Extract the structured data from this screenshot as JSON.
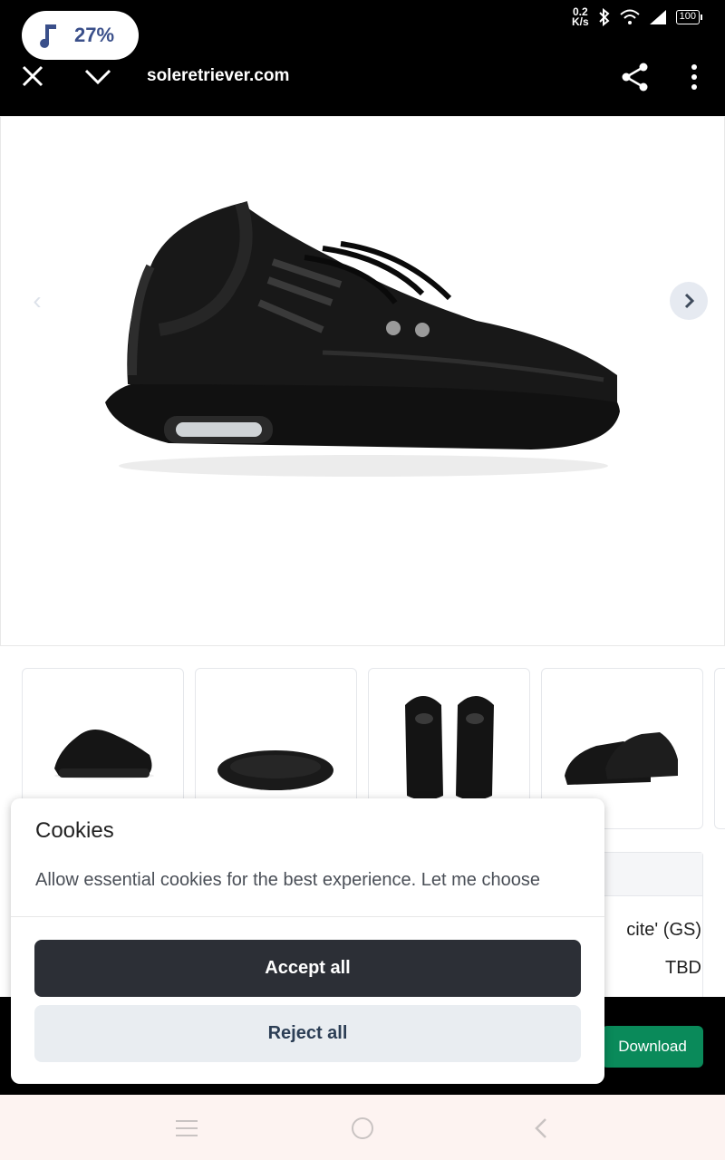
{
  "status_bar": {
    "music_percent": "27%",
    "net_speed_value": "0.2",
    "net_speed_unit": "K/s",
    "battery": "100"
  },
  "browser": {
    "url": "soleretriever.com"
  },
  "cookie_banner": {
    "title": "Cookies",
    "message": "Allow essential cookies for the best experience. Let me choose",
    "accept_label": "Accept all",
    "reject_label": "Reject all"
  },
  "product_table": {
    "name_fragment": "cite' (GS)",
    "release_date": "TBD"
  },
  "download_label": "Download",
  "icons": [
    "music-note-icon",
    "bluetooth-icon",
    "wifi-icon",
    "signal-icon",
    "close-icon",
    "chevron-down-icon",
    "share-icon",
    "more-icon",
    "chevron-left-icon",
    "chevron-right-icon",
    "menu-icon",
    "home-icon",
    "back-icon"
  ],
  "colors": {
    "accept_button": "#2c2f36",
    "reject_button": "#e9edf1",
    "download_button": "#0a8a5a",
    "music_text": "#3a4f8a"
  }
}
